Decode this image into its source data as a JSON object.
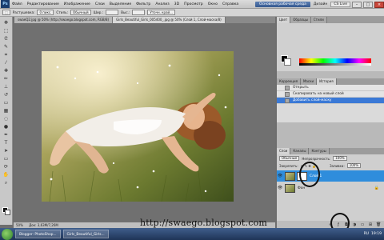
{
  "menubar": {
    "logo": "Ps",
    "items": [
      "Файл",
      "Редактирование",
      "Изображение",
      "Слои",
      "Выделение",
      "Фильтр",
      "Анализ",
      "3D",
      "Просмотр",
      "Окно",
      "Справка"
    ],
    "zoom": "50%",
    "workspace": "Основная рабочая среда",
    "design": "Дизайн",
    "cslive": "CS Live"
  },
  "optbar": {
    "feather_label": "Растушевка:",
    "feather_value": "0 пикс.",
    "style_label": "Стиль:",
    "style_value": "Обычный",
    "width_label": "Шир.:",
    "height_label": "Выс.:",
    "refine": "Уточн. край..."
  },
  "tabs": [
    {
      "label": "swaeQ2.jpg @ 50% (http://swaego.blogspot.com, RGB/8)",
      "active": false
    },
    {
      "label": "Girls_Beautiful_Girls_005400_.jpg @ 50% (Слой 1, Слой-маска/8)",
      "active": true
    }
  ],
  "status": {
    "zoom": "50%",
    "doc": "Док: 3,63М/7,26М"
  },
  "panels": {
    "color_tabs": [
      "Цвет",
      "Образцы",
      "Стили"
    ],
    "adj_tabs": [
      "Коррекция",
      "Маски",
      "История"
    ],
    "history": [
      {
        "label": "Открыть",
        "active": false
      },
      {
        "label": "Скопировать на новый слой",
        "active": false
      },
      {
        "label": "Добавить слой-маску",
        "active": true
      }
    ],
    "layers_tabs": [
      "Слои",
      "Каналы",
      "Контуры"
    ],
    "blend_mode": "Обычные",
    "opacity_label": "Непрозрачность:",
    "opacity": "100%",
    "lock_label": "Закрепить:",
    "fill_label": "Заливка:",
    "fill": "100%",
    "layers": [
      {
        "name": "Слой 1",
        "selected": true
      },
      {
        "name": "Фон",
        "selected": false
      }
    ]
  },
  "watermark": "http://swaego.blogspot.com",
  "taskbar": {
    "buttons": [
      "Blogger: PhotoShop...",
      "Girls_Beautiful_Girls..."
    ],
    "lang": "RU",
    "time": "19:19"
  }
}
